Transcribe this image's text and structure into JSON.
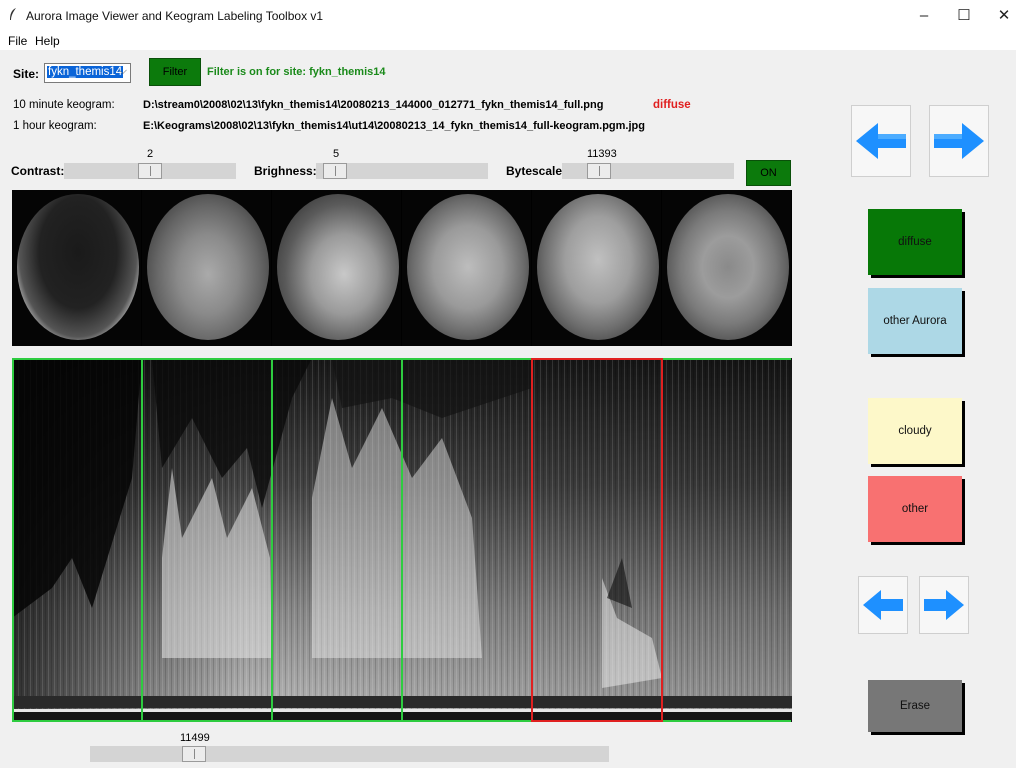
{
  "window": {
    "title": "Aurora Image Viewer and Keogram Labeling Toolbox v1",
    "controls": [
      "–",
      "☐",
      "✕"
    ]
  },
  "menu": [
    "File",
    "Help"
  ],
  "site": {
    "label": "Site:",
    "selected": "fykn_themis14",
    "filter_button": "Filter",
    "filter_status": "Filter is on for site:  fykn_themis14"
  },
  "keograms": {
    "ten_min_label": "10 minute keogram:",
    "ten_min_path": "D:\\stream0\\2008\\02\\13\\fykn_themis14\\20080213_144000_012771_fykn_themis14_full.png",
    "current_label": "diffuse",
    "one_hour_label": "1 hour keogram:",
    "one_hour_path": "E:\\Keograms\\2008\\02\\13\\fykn_themis14\\ut14\\20080213_14_fykn_themis14_full-keogram.pgm.jpg"
  },
  "sliders": {
    "contrast_label": "Contrast:",
    "contrast_value": "2",
    "brightness_label": "Brighness:",
    "brightness_value": "5",
    "bytescale_label": "Bytescale:",
    "bytescale_value": "11393",
    "on_button": "ON",
    "bottom_value": "11499"
  },
  "labels": {
    "diffuse": "diffuse",
    "other_aurora": "other Aurora",
    "cloudy": "cloudy",
    "other": "other",
    "erase": "Erase"
  },
  "colors": {
    "diffuse": "#077807",
    "other_aurora": "#add8e6",
    "cloudy": "#fdf8c9",
    "other": "#f87171",
    "erase": "#777777",
    "segment_border": "#2ecc40",
    "selected_segment": "#e02020",
    "arrow": "#1e90ff"
  },
  "icons": {
    "app": "feather-icon",
    "big_left": "left-arrow-icon",
    "big_right": "right-arrow-icon",
    "small_left": "left-arrow-icon",
    "small_right": "right-arrow-icon"
  }
}
